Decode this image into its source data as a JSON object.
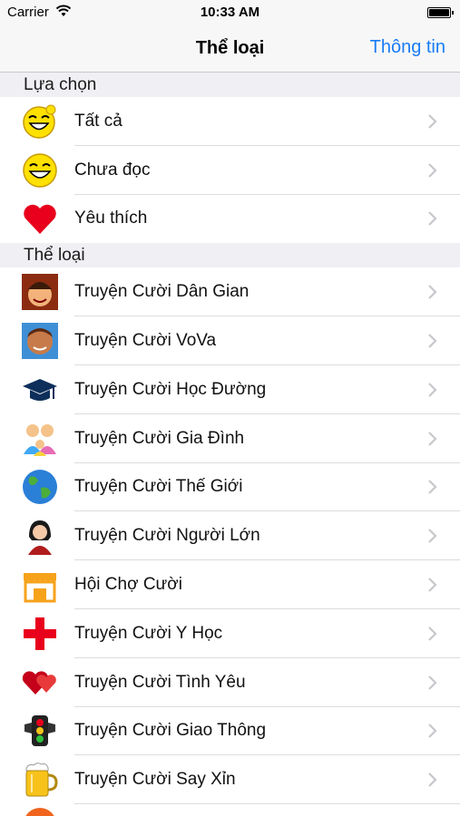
{
  "status_bar": {
    "carrier": "Carrier",
    "time": "10:33 AM"
  },
  "nav": {
    "title": "Thể loại",
    "info_label": "Thông tin"
  },
  "sections": [
    {
      "header": "Lựa chọn",
      "rows": [
        {
          "label": "Tất cả",
          "icon": "laughing-smiley-icon"
        },
        {
          "label": "Chưa đọc",
          "icon": "smiley-icon"
        },
        {
          "label": "Yêu thích",
          "icon": "heart-icon"
        }
      ]
    },
    {
      "header": "Thể loại",
      "rows": [
        {
          "label": "Truyện Cười Dân Gian",
          "icon": "folk-character-icon"
        },
        {
          "label": "Truyện Cười VoVa",
          "icon": "boy-face-icon"
        },
        {
          "label": "Truyện Cười Học Đường",
          "icon": "graduation-cap-icon"
        },
        {
          "label": "Truyện Cười Gia Đình",
          "icon": "family-icon"
        },
        {
          "label": "Truyện Cười Thế Giới",
          "icon": "globe-icon"
        },
        {
          "label": "Truyện Cười Người Lớn",
          "icon": "woman-icon"
        },
        {
          "label": "Hội Chợ Cười",
          "icon": "market-stall-icon"
        },
        {
          "label": "Truyện Cười Y Học",
          "icon": "medical-cross-icon"
        },
        {
          "label": "Truyện Cười Tình Yêu",
          "icon": "hearts-icon"
        },
        {
          "label": "Truyện Cười Giao Thông",
          "icon": "traffic-light-icon"
        },
        {
          "label": "Truyện Cười Say Xỉn",
          "icon": "beer-mug-icon"
        }
      ]
    }
  ]
}
